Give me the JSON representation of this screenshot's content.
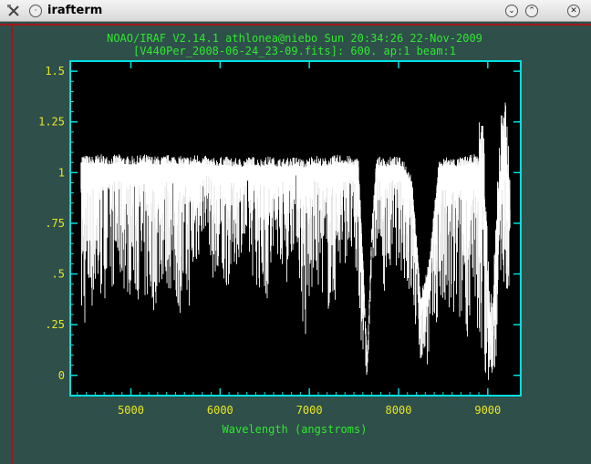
{
  "window": {
    "title": "irafterm"
  },
  "plot": {
    "header_line1": "NOAO/IRAF V2.14.1 athlonea@niebo Sun 20:34:26 22-Nov-2009",
    "header_line2": "[V440Per_2008-06-24_23-09.fits]:  600. ap:1 beam:1",
    "xlabel": "Wavelength (angstroms)"
  },
  "chart_data": {
    "type": "line",
    "title": "NOAO/IRAF V2.14.1 athlonea@niebo Sun 20:34:26 22-Nov-2009",
    "subtitle": "[V440Per_2008-06-24_23-09.fits]:  600. ap:1 beam:1",
    "xlabel": "Wavelength (angstroms)",
    "ylabel": "",
    "xlim": [
      4320,
      9370
    ],
    "ylim": [
      -0.1,
      1.55
    ],
    "x_ticks": [
      "5000",
      "6000",
      "7000",
      "8000",
      "9000"
    ],
    "y_ticks": [
      "0",
      ".25",
      ".5",
      ".75",
      "1",
      "1.25",
      "1.5"
    ],
    "series": [
      {
        "x": [
          4450,
          4550,
          4650,
          4750,
          4850,
          4950,
          5050,
          5150,
          5250,
          5350,
          5450,
          5550,
          5650,
          5750,
          5850,
          5950,
          6050,
          6150,
          6250,
          6350,
          6450,
          6550,
          6650,
          6750,
          6850,
          6950,
          7050,
          7150,
          7250,
          7350,
          7450,
          7550,
          7600,
          7650,
          7700,
          7750,
          7850,
          7950,
          8050,
          8150,
          8250,
          8350,
          8450,
          8550,
          8650,
          8750,
          8850,
          8950,
          9000,
          9050,
          9100,
          9150,
          9200,
          9250
        ],
        "y": [
          1.05,
          1.04,
          1.05,
          1.04,
          1.05,
          1.04,
          1.04,
          1.05,
          1.04,
          1.04,
          1.05,
          1.04,
          1.04,
          1.05,
          1.04,
          1.03,
          1.04,
          1.03,
          1.03,
          1.04,
          1.03,
          1.04,
          1.03,
          1.03,
          1.04,
          1.02,
          1.05,
          1.03,
          1.04,
          1.05,
          1.04,
          1.03,
          0.55,
          0.05,
          0.7,
          1.04,
          1.03,
          1.04,
          1.03,
          0.95,
          0.35,
          0.55,
          1.02,
          1.04,
          1.03,
          1.04,
          1.05,
          1.02,
          0.4,
          0.1,
          0.6,
          1.05,
          1.1,
          0.8
        ],
        "min_envelope": [
          0.18,
          0.3,
          0.35,
          0.4,
          0.45,
          0.4,
          0.38,
          0.35,
          0.3,
          0.45,
          0.4,
          0.3,
          0.32,
          0.55,
          0.75,
          0.35,
          0.4,
          0.5,
          0.62,
          0.5,
          0.4,
          0.35,
          0.6,
          0.45,
          0.7,
          0.1,
          0.45,
          0.4,
          0.25,
          0.5,
          0.6,
          0.35,
          0.05,
          -0.02,
          0.5,
          0.6,
          0.4,
          0.55,
          0.5,
          0.3,
          0.05,
          0.05,
          0.3,
          0.2,
          0.25,
          0.2,
          0.15,
          0.05,
          -0.02,
          -0.05,
          0.1,
          0.55,
          0.4,
          0.2
        ]
      }
    ]
  }
}
